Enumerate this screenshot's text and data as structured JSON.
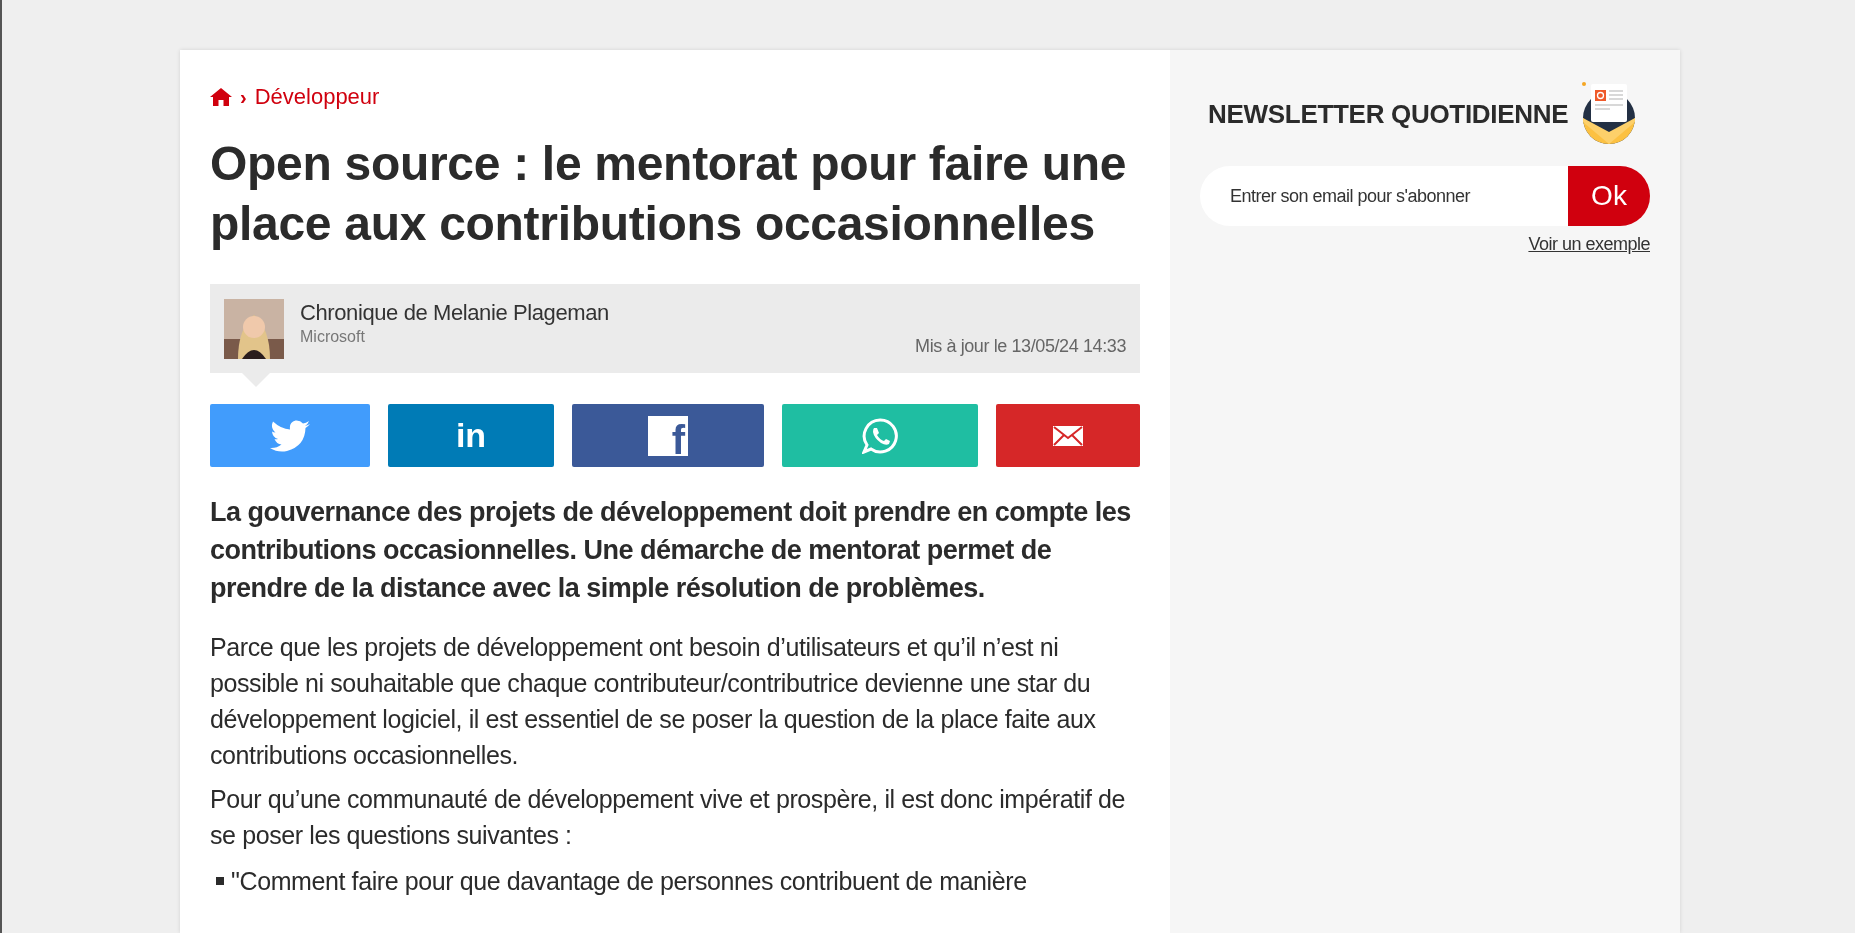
{
  "breadcrumb": {
    "separator": "›",
    "section": "Développeur"
  },
  "article": {
    "title": "Open source : le mentorat pour faire une place aux contributions occasionnelles",
    "author": {
      "byline": "Chronique de Melanie Plageman",
      "company": "Microsoft",
      "updated": "Mis à jour le 13/05/24 14:33"
    },
    "share_buttons": [
      {
        "kind": "twitter",
        "color": "#419cfc"
      },
      {
        "kind": "linkedin",
        "color": "#007bb6",
        "label": "in"
      },
      {
        "kind": "facebook",
        "color": "#3b5998",
        "label": "f"
      },
      {
        "kind": "whatsapp",
        "color": "#1fbea2"
      },
      {
        "kind": "email",
        "color": "#d62728"
      }
    ],
    "lead": "La gouvernance des projets de développement doit prendre en compte les contributions occasionnelles. Une démarche de mentorat permet de prendre de la distance avec la simple résolution de problèmes.",
    "paragraphs": [
      "Parce que les projets de développement ont besoin d’utilisateurs et qu’il n’est ni possible ni souhaitable que chaque contributeur/contributrice devienne une star du développement logiciel, il est essentiel de se poser la question de la place faite aux contributions occasionnelles.",
      "Pour qu’une communauté de développement vive et prospère, il est donc impératif de se poser les questions suivantes :"
    ],
    "list_items": [
      "\"Comment faire pour que davantage de personnes contribuent de manière"
    ]
  },
  "newsletter": {
    "title": "NEWSLETTER QUOTIDIENNE",
    "placeholder": "Entrer son email pour s'abonner",
    "button": "Ok",
    "example_link": "Voir un exemple"
  }
}
